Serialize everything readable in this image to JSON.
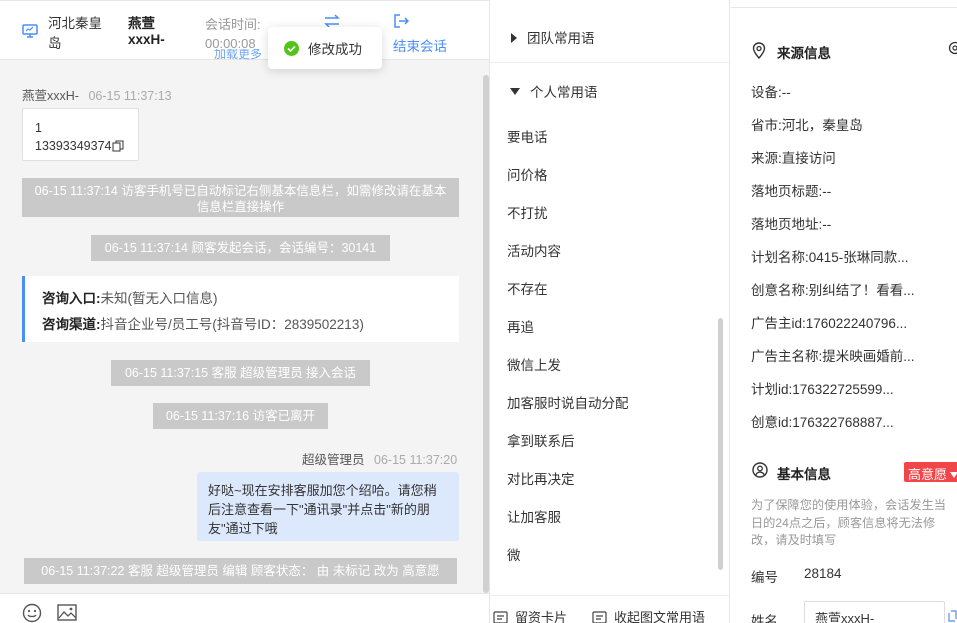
{
  "header": {
    "location": "河北秦皇岛",
    "visitor_name": "燕萱xxxH-",
    "session_time_label": "会话时间:",
    "session_time_value": "00:00:08",
    "end_session_label": "结束会话",
    "load_more_partial": "加载更多"
  },
  "toast": {
    "text": "修改成功"
  },
  "chat": {
    "visitor_msg": {
      "sender": "燕萱xxxH-",
      "time": "06-15 11:37:13",
      "line1": "1",
      "line2": "13393349374"
    },
    "system_messages": [
      "06-15 11:37:14 访客手机号已自动标记右侧基本信息栏，如需修改请在基本信息栏直接操作",
      "06-15 11:37:14 顾客发起会话，会话编号：30141"
    ],
    "consult_card": {
      "entry_label": "咨询入口:",
      "entry_value": "未知(暂无入口信息)",
      "channel_label": "咨询渠道:",
      "channel_value": "抖音企业号/员工号(抖音号ID：2839502213)"
    },
    "system_messages_2": [
      "06-15 11:37:15 客服 超级管理员 接入会话",
      "06-15 11:37:16 访客已离开"
    ],
    "agent_msg": {
      "sender": "超级管理员",
      "time": "06-15 11:37:20",
      "text": "好哒~现在安排客服加您个绍哈。请您稍后注意查看一下\"通讯录\"并点击\"新的朋友\"通过下哦"
    },
    "system_last": "06-15 11:37:22 客服 超级管理员 编辑 顾客状态： 由 未标记 改为 高意愿"
  },
  "phrases": {
    "team_label": "团队常用语",
    "personal_label": "个人常用语",
    "items": [
      "要电话",
      "问价格",
      "不打扰",
      "活动内容",
      "不存在",
      "再追",
      "微信上发",
      "加客服时说自动分配",
      "拿到联系后",
      "对比再决定",
      "让加客服",
      "微"
    ],
    "footer_card": "留资卡片",
    "footer_collect": "收起图文常用语"
  },
  "info": {
    "source_title": "来源信息",
    "rows": [
      {
        "label": "设备:",
        "value": "--"
      },
      {
        "label": "省市:",
        "value": "河北，秦皇岛"
      },
      {
        "label": "来源:",
        "value": "直接访问"
      },
      {
        "label": "落地页标题:",
        "value": "--"
      },
      {
        "label": "落地页地址:",
        "value": "--"
      },
      {
        "label": "计划名称:",
        "value": "0415-张琳同款..."
      },
      {
        "label": "创意名称:",
        "value": "别纠结了！看看..."
      },
      {
        "label": "广告主id:",
        "value": "176022240796..."
      },
      {
        "label": "广告主名称:",
        "value": "提米映画婚前..."
      },
      {
        "label": "计划id:",
        "value": "176322725599..."
      },
      {
        "label": "创意id:",
        "value": "176322768887..."
      }
    ],
    "basic_title": "基本信息",
    "intent_badge": "高意愿",
    "notice": "为了保障您的使用体验，会话发生当日的24点之后，顾客信息将无法修改，请及时填写",
    "id_label": "编号",
    "id_value": "28184",
    "name_label": "姓名",
    "name_value": "燕萱xxxH-"
  },
  "colors": {
    "accent": "#4a8ff5",
    "badge": "#f0464a",
    "system_bg": "#c9c9c9",
    "agent_bubble": "#dce8fc",
    "success": "#52c41a"
  }
}
